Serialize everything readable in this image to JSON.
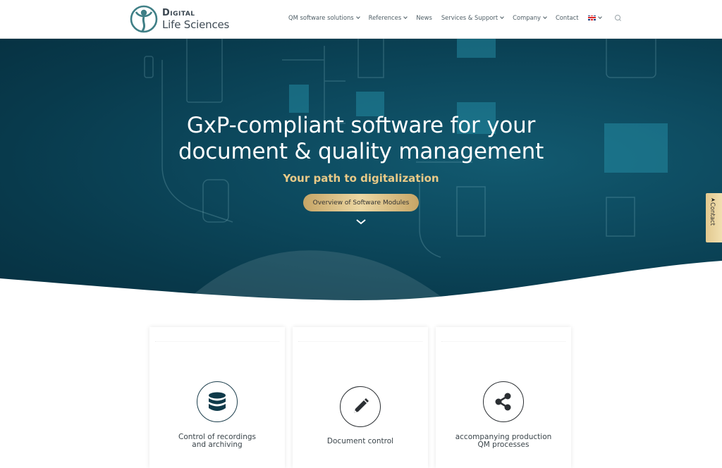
{
  "brand": {
    "line1": "Digital",
    "line2": "Life Sciences"
  },
  "nav": {
    "items": [
      {
        "label": "QM software solutions",
        "dropdown": true
      },
      {
        "label": "References",
        "dropdown": true
      },
      {
        "label": "News",
        "dropdown": false
      },
      {
        "label": "Services & Support",
        "dropdown": true
      },
      {
        "label": "Company",
        "dropdown": true
      },
      {
        "label": "Contact",
        "dropdown": false
      }
    ],
    "language_icon": "uk-flag-icon",
    "search_icon": "search-icon"
  },
  "hero": {
    "title_line1": "GxP-compliant software for your",
    "title_line2": "document & quality management",
    "subtitle": "Your path to digitalization",
    "button_label": "Overview of Software Modules",
    "scroll_icon": "chevron-down-icon"
  },
  "contact_tab": {
    "label": "Contact",
    "icon": "paper-plane-icon"
  },
  "colors": {
    "accent_gold": "#e8c987",
    "dark_teal": "#083a4c",
    "icon_navy": "#1d3f4d"
  },
  "cards": [
    {
      "title_line1": "Control of recordings",
      "title_line2": "and archiving",
      "icon": "database-icon"
    },
    {
      "title_line1": "Document control",
      "title_line2": "",
      "icon": "pencil-icon"
    },
    {
      "title_line1": "accompanying production",
      "title_line2": "QM processes",
      "icon": "share-icon"
    }
  ]
}
